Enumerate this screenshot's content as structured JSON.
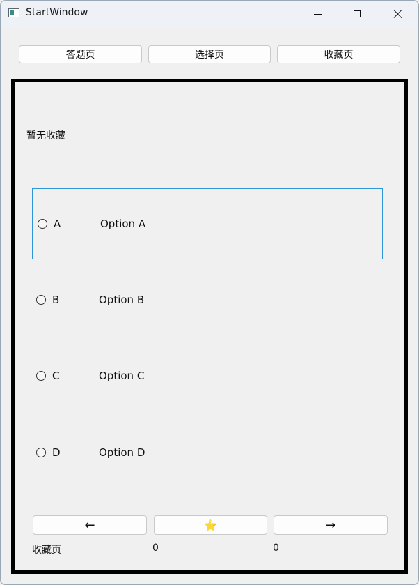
{
  "window": {
    "title": "StartWindow"
  },
  "nav": {
    "answer_label": "答题页",
    "select_label": "选择页",
    "favorites_label": "收藏页"
  },
  "panel": {
    "status_text": "暂无收藏",
    "options": [
      {
        "letter": "A",
        "text": "Option A",
        "selected": false,
        "focused": true
      },
      {
        "letter": "B",
        "text": "Option B",
        "selected": false,
        "focused": false
      },
      {
        "letter": "C",
        "text": "Option C",
        "selected": false,
        "focused": false
      },
      {
        "letter": "D",
        "text": "Option D",
        "selected": false,
        "focused": false
      }
    ],
    "prev_label": "←",
    "star_label": "⭐",
    "next_label": "→",
    "footer_label": "收藏页",
    "footer_count_1": "0",
    "footer_count_2": "0"
  },
  "colors": {
    "focus_border": "#2f94d8",
    "panel_border": "#000000",
    "star": "#f0c419"
  },
  "icons": {
    "app": "app-window-icon",
    "minimize": "minimize-icon",
    "maximize": "maximize-icon",
    "close": "close-icon"
  }
}
